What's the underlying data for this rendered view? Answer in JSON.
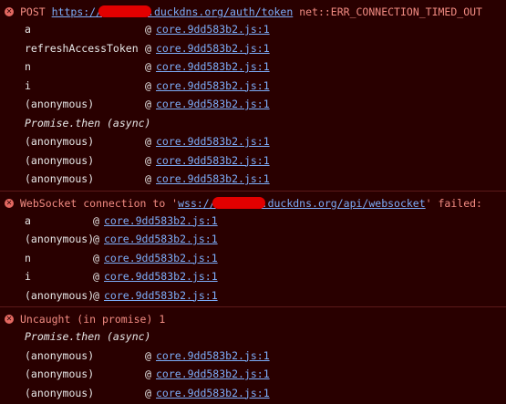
{
  "colors": {
    "background": "#290000",
    "error_text": "#f28b82",
    "link": "#7cacf8",
    "border": "#5c1a1a"
  },
  "messages": [
    {
      "icon": "error-icon",
      "prefix": "POST ",
      "url_start": "https://",
      "url_end": ".duckdns.org/auth/token",
      "suffix": " net::ERR_CONNECTION_TIMED_OUT",
      "frames": [
        {
          "fn": "a",
          "at": "@",
          "loc": "core.9dd583b2.js:1"
        },
        {
          "fn": "refreshAccessToken",
          "at": "@",
          "loc": "core.9dd583b2.js:1"
        },
        {
          "fn": "n",
          "at": "@",
          "loc": "core.9dd583b2.js:1"
        },
        {
          "fn": "i",
          "at": "@",
          "loc": "core.9dd583b2.js:1"
        },
        {
          "fn": "(anonymous)",
          "at": "@",
          "loc": "core.9dd583b2.js:1"
        },
        {
          "async": "Promise.then (async)"
        },
        {
          "fn": "(anonymous)",
          "at": "@",
          "loc": "core.9dd583b2.js:1"
        },
        {
          "fn": "(anonymous)",
          "at": "@",
          "loc": "core.9dd583b2.js:1"
        },
        {
          "fn": "(anonymous)",
          "at": "@",
          "loc": "core.9dd583b2.js:1"
        }
      ]
    },
    {
      "icon": "error-icon",
      "prefix": "WebSocket connection to '",
      "url_start": "wss://",
      "url_end": ".duckdns.org/api/websocket",
      "suffix": "' failed:",
      "frames": [
        {
          "fn": "a",
          "at": "@",
          "loc": "core.9dd583b2.js:1"
        },
        {
          "fn": "(anonymous)",
          "at": "@",
          "loc": "core.9dd583b2.js:1"
        },
        {
          "fn": "n",
          "at": "@",
          "loc": "core.9dd583b2.js:1"
        },
        {
          "fn": "i",
          "at": "@",
          "loc": "core.9dd583b2.js:1"
        },
        {
          "fn": "(anonymous)",
          "at": "@",
          "loc": "core.9dd583b2.js:1"
        }
      ]
    },
    {
      "icon": "error-icon",
      "text": "Uncaught (in promise) 1",
      "frames": [
        {
          "async": "Promise.then (async)"
        },
        {
          "fn": "(anonymous)",
          "at": "@",
          "loc": "core.9dd583b2.js:1"
        },
        {
          "fn": "(anonymous)",
          "at": "@",
          "loc": "core.9dd583b2.js:1"
        },
        {
          "fn": "(anonymous)",
          "at": "@",
          "loc": "core.9dd583b2.js:1"
        }
      ]
    }
  ]
}
